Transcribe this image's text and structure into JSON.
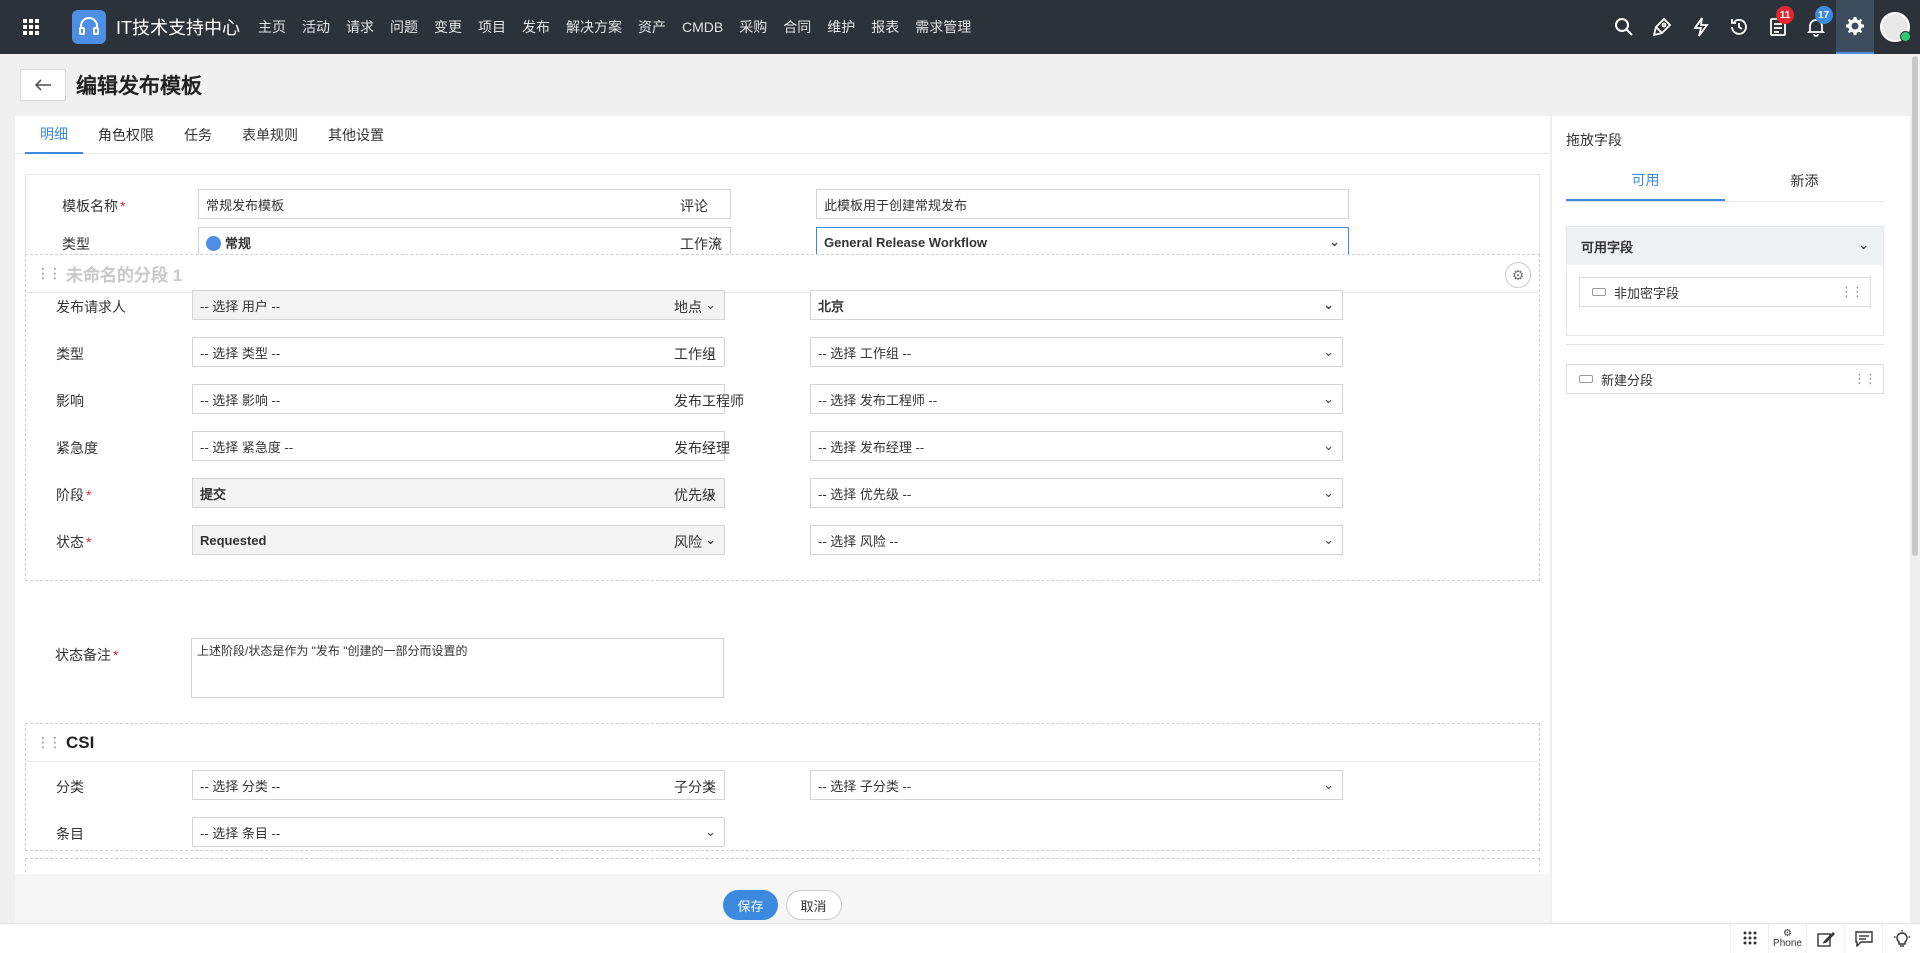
{
  "topbar": {
    "brand": "IT技术支持中心",
    "nav": [
      "主页",
      "活动",
      "请求",
      "问题",
      "变更",
      "项目",
      "发布",
      "解决方案",
      "资产",
      "CMDB",
      "采购",
      "合同",
      "维护",
      "报表",
      "需求管理"
    ],
    "icons": [
      "search-icon",
      "rocket-icon",
      "lightning-icon",
      "history-icon",
      "tasks-icon",
      "bell-icon",
      "settings-icon"
    ],
    "tasks_badge": "11",
    "notif_badge": "17"
  },
  "page": {
    "title": "编辑发布模板"
  },
  "tabs": [
    "明细",
    "角色权限",
    "任务",
    "表单规则",
    "其他设置"
  ],
  "header_fields": {
    "name_label": "模板名称",
    "name_value": "常规发布模板",
    "comment_label": "评论",
    "comment_value": "此模板用于创建常规发布",
    "type_label": "类型",
    "type_value": "常规",
    "workflow_label": "工作流",
    "workflow_value": "General Release Workflow"
  },
  "section1": {
    "title": "未命名的分段 1",
    "left": [
      {
        "label": "发布请求人",
        "value": "-- 选择 用户 --",
        "required": false
      },
      {
        "label": "类型",
        "value": "-- 选择 类型 --",
        "required": false
      },
      {
        "label": "影响",
        "value": "-- 选择 影响 --",
        "required": false
      },
      {
        "label": "紧急度",
        "value": "-- 选择 紧急度 --",
        "required": false
      },
      {
        "label": "阶段",
        "value": "提交",
        "required": true
      },
      {
        "label": "状态",
        "value": "Requested",
        "required": true
      }
    ],
    "right": [
      {
        "label": "地点",
        "value": "北京"
      },
      {
        "label": "工作组",
        "value": "-- 选择 工作组 --"
      },
      {
        "label": "发布工程师",
        "value": "-- 选择 发布工程师 --"
      },
      {
        "label": "发布经理",
        "value": "-- 选择 发布经理 --"
      },
      {
        "label": "优先级",
        "value": "-- 选择 优先级 --"
      },
      {
        "label": "风险",
        "value": "-- 选择 风险 --"
      }
    ],
    "status_note_label": "状态备注",
    "status_note_value": "上述阶段/状态是作为 \"发布 \"创建的一部分而设置的"
  },
  "section2": {
    "title": "CSI",
    "category_label": "分类",
    "category_value": "-- 选择 分类 --",
    "subcategory_label": "子分类",
    "subcategory_value": "-- 选择 子分类 --",
    "item_label": "条目",
    "item_value": "-- 选择 条目 --"
  },
  "footer": {
    "save": "保存",
    "cancel": "取消"
  },
  "sidebar": {
    "title": "拖放字段",
    "tab_available": "可用",
    "tab_new": "新添",
    "available_header": "可用字段",
    "field_unencrypted": "非加密字段",
    "new_section": "新建分段"
  },
  "statusbar": {
    "phone": "Phone"
  },
  "colors": {
    "accent": "#3b8ae0",
    "topbar": "#2c3239",
    "required": "#d9232d"
  }
}
